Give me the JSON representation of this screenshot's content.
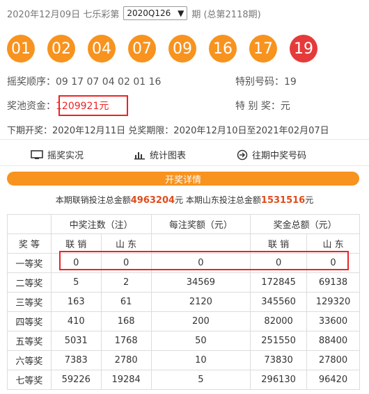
{
  "header": {
    "date": "2020年12月09日",
    "lottery_name": "七乐彩第",
    "period_selected": "2020Q126",
    "period_suffix": "期 (总第2118期)"
  },
  "balls": [
    "01",
    "02",
    "04",
    "07",
    "09",
    "16",
    "17",
    "19"
  ],
  "special_ball_index": 7,
  "info": {
    "draw_order_label": "摇奖顺序：",
    "draw_order": "09 17 07 04 02 01 16",
    "special_label": "特别号码：",
    "special_value": "19",
    "pool_label": "奖池资金：",
    "pool_value": "1209921元",
    "special_prize_label": "特 别 奖：",
    "special_prize_value": "元"
  },
  "next": "下期开奖：2020年12月11日 兑奖期限：2020年12月10日至2021年02月07日",
  "links": {
    "live": "摇奖实况",
    "chart": "统计图表",
    "history": "往期中奖号码"
  },
  "detail_bar": "开奖详情",
  "summary": {
    "prefix": "本期联销投注总金额",
    "total_joint": "4963204",
    "middle": "元 本期山东投注总金额",
    "total_sd": "1531516",
    "suffix": "元"
  },
  "table": {
    "group_count": "中奖注数（注）",
    "group_per": "每注奖额（元）",
    "group_total": "奖金总额（元）",
    "col_level": "奖 等",
    "col_joint": "联 销",
    "col_sd": "山 东",
    "col_joint2": "联 销",
    "col_sd2": "山 东",
    "rows": [
      {
        "level": "一等奖",
        "joint": "0",
        "sd": "0",
        "per": "0",
        "total_joint": "0",
        "total_sd": "0"
      },
      {
        "level": "二等奖",
        "joint": "5",
        "sd": "2",
        "per": "34569",
        "total_joint": "172845",
        "total_sd": "69138"
      },
      {
        "level": "三等奖",
        "joint": "163",
        "sd": "61",
        "per": "2120",
        "total_joint": "345560",
        "total_sd": "129320"
      },
      {
        "level": "四等奖",
        "joint": "410",
        "sd": "168",
        "per": "200",
        "total_joint": "82000",
        "total_sd": "33600"
      },
      {
        "level": "五等奖",
        "joint": "5031",
        "sd": "1768",
        "per": "50",
        "total_joint": "251550",
        "total_sd": "88400"
      },
      {
        "level": "六等奖",
        "joint": "7383",
        "sd": "2780",
        "per": "10",
        "total_joint": "73830",
        "total_sd": "27800"
      },
      {
        "level": "七等奖",
        "joint": "59226",
        "sd": "19284",
        "per": "5",
        "total_joint": "296130",
        "total_sd": "96420"
      }
    ]
  }
}
